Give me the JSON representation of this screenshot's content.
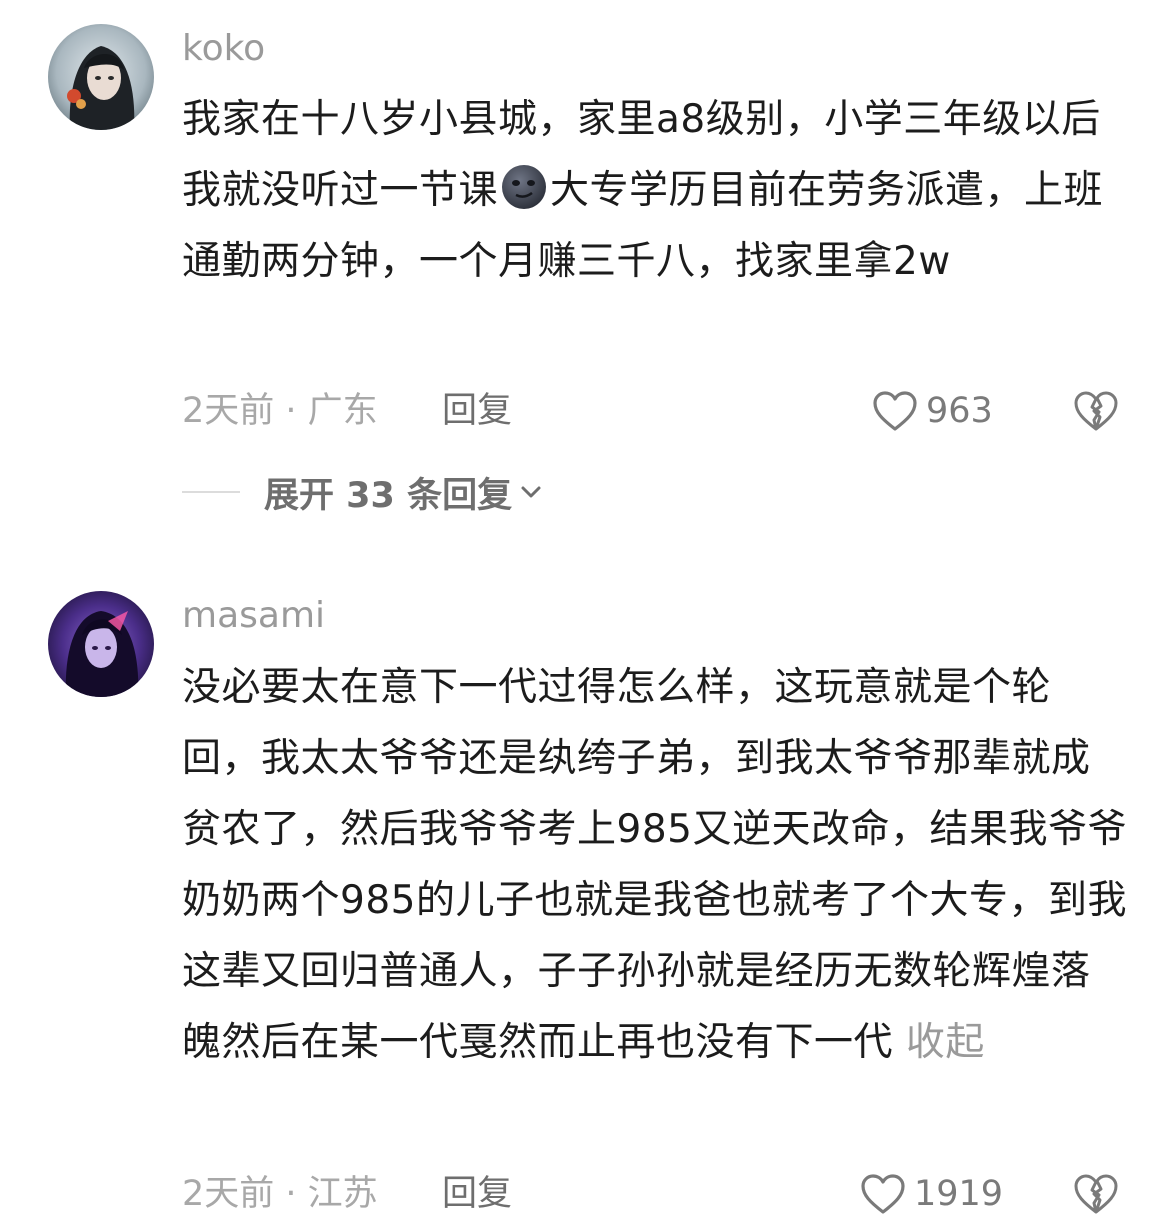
{
  "comments": [
    {
      "username": "koko",
      "avatar": "dark-haired-anime-avatar",
      "text_parts": [
        "我家在十八岁小县城，家里a8级别，小学三年级以后我就没听过一节课",
        "大专学历目前在劳务派遣，上班通勤两分钟，一个月赚三千八，找家里拿2w"
      ],
      "inline_emoji": "smirking-dark-face-emoji",
      "meta": "2天前 · 广东",
      "reply_label": "回复",
      "like_count": "963",
      "expand_label": "展开 33 条回复"
    },
    {
      "username": "masami",
      "avatar": "purple-anime-avatar",
      "text": "没必要太在意下一代过得怎么样，这玩意就是个轮回，我太太爷爷还是纨绔子弟，到我太爷爷那辈就成贫农了，然后我爷爷考上985又逆天改命，结果我爷爷奶奶两个985的儿子也就是我爸也就考了个大专，到我这辈又回归普通人，子子孙孙就是经历无数轮辉煌落魄然后在某一代戛然而止再也没有下一代",
      "collapse_label": "收起",
      "meta": "2天前 · 江苏",
      "reply_label": "回复",
      "like_count": "1919"
    }
  ],
  "colors": {
    "text": "#1c1c1c",
    "muted": "#9a9a9a",
    "action": "#6e6e6e",
    "divider": "#dcdcdc"
  },
  "icons": [
    "heart-outline-icon",
    "broken-heart-icon",
    "chevron-down-icon"
  ]
}
